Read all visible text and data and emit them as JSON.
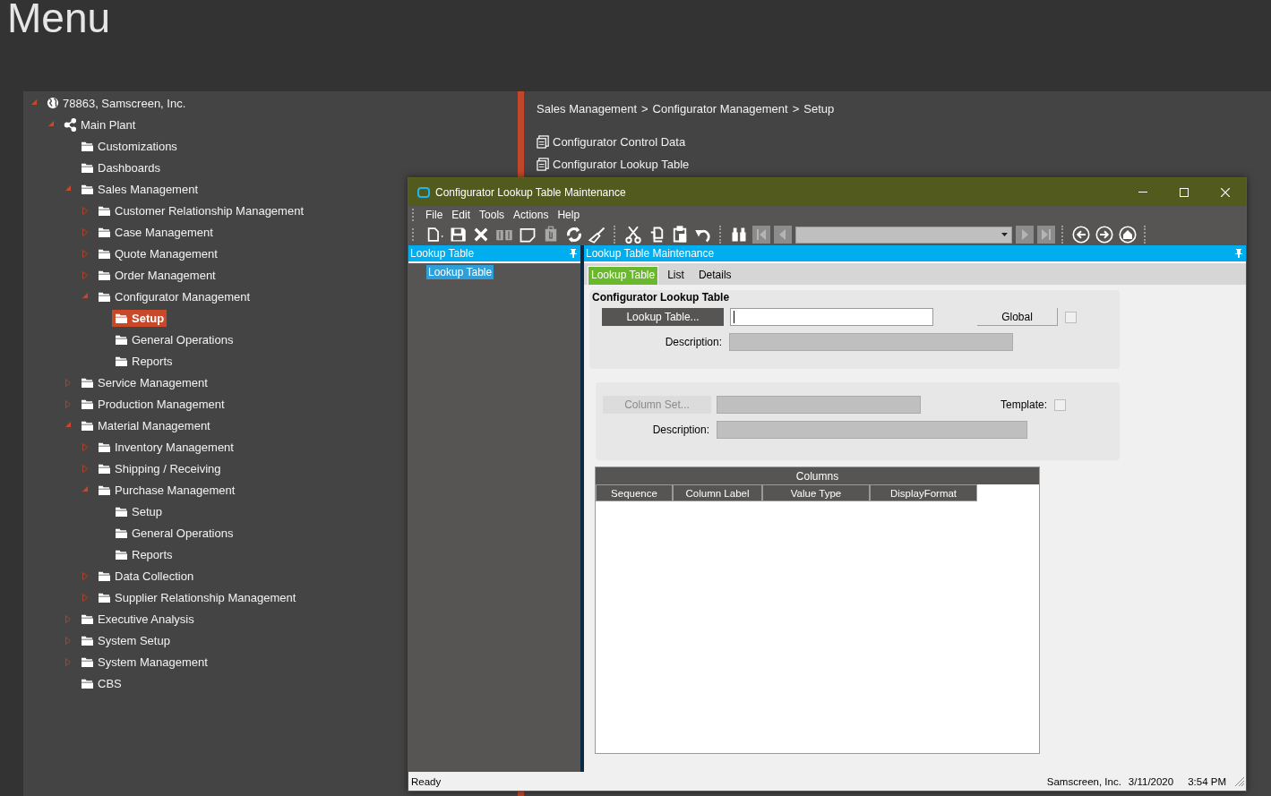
{
  "page_title": "Menu",
  "tree": [
    {
      "label": "78863, Samscreen, Inc.",
      "kind": "globe",
      "expanded": true,
      "selected": false,
      "children": [
        {
          "label": "Main Plant",
          "kind": "share",
          "expanded": true,
          "selected": false,
          "children": [
            {
              "label": "Customizations",
              "kind": "folder",
              "selected": false
            },
            {
              "label": "Dashboards",
              "kind": "folder",
              "selected": false
            },
            {
              "label": "Sales Management",
              "kind": "folder",
              "expanded": true,
              "selected": false,
              "children": [
                {
                  "label": "Customer Relationship Management",
                  "kind": "folder",
                  "expanded": false,
                  "selected": false
                },
                {
                  "label": "Case Management",
                  "kind": "folder",
                  "expanded": false,
                  "selected": false
                },
                {
                  "label": "Quote Management",
                  "kind": "folder",
                  "expanded": false,
                  "selected": false
                },
                {
                  "label": "Order Management",
                  "kind": "folder",
                  "expanded": false,
                  "selected": false
                },
                {
                  "label": "Configurator Management",
                  "kind": "folder",
                  "expanded": true,
                  "selected": false,
                  "children": [
                    {
                      "label": "Setup",
                      "kind": "folder",
                      "selected": true
                    },
                    {
                      "label": "General Operations",
                      "kind": "folder",
                      "selected": false
                    },
                    {
                      "label": "Reports",
                      "kind": "folder",
                      "selected": false
                    }
                  ]
                }
              ]
            },
            {
              "label": "Service Management",
              "kind": "folder",
              "expanded": false,
              "selected": false
            },
            {
              "label": "Production Management",
              "kind": "folder",
              "expanded": false,
              "selected": false
            },
            {
              "label": "Material Management",
              "kind": "folder",
              "expanded": true,
              "selected": false,
              "children": [
                {
                  "label": "Inventory Management",
                  "kind": "folder",
                  "expanded": false,
                  "selected": false
                },
                {
                  "label": "Shipping / Receiving",
                  "kind": "folder",
                  "expanded": false,
                  "selected": false
                },
                {
                  "label": "Purchase Management",
                  "kind": "folder",
                  "expanded": true,
                  "selected": false,
                  "children": [
                    {
                      "label": "Setup",
                      "kind": "folder",
                      "selected": false
                    },
                    {
                      "label": "General Operations",
                      "kind": "folder",
                      "selected": false
                    },
                    {
                      "label": "Reports",
                      "kind": "folder",
                      "selected": false
                    }
                  ]
                },
                {
                  "label": "Data Collection",
                  "kind": "folder",
                  "expanded": false,
                  "selected": false
                },
                {
                  "label": "Supplier Relationship Management",
                  "kind": "folder",
                  "expanded": false,
                  "selected": false
                }
              ]
            },
            {
              "label": "Executive Analysis",
              "kind": "folder",
              "expanded": false,
              "selected": false
            },
            {
              "label": "System Setup",
              "kind": "folder",
              "expanded": false,
              "selected": false
            },
            {
              "label": "System Management",
              "kind": "folder",
              "expanded": false,
              "selected": false
            },
            {
              "label": "CBS",
              "kind": "folder",
              "selected": false
            }
          ]
        }
      ]
    }
  ],
  "breadcrumb": {
    "separator": ">",
    "items": [
      "Sales Management",
      "Configurator Management",
      "Setup"
    ]
  },
  "links": [
    "Configurator Control Data",
    "Configurator Lookup Table"
  ],
  "window": {
    "title": "Configurator Lookup Table Maintenance",
    "menu": [
      "File",
      "Edit",
      "Tools",
      "Actions",
      "Help"
    ],
    "toolbar": [
      {
        "kind": "new",
        "disabled": false
      },
      {
        "kind": "save",
        "disabled": false
      },
      {
        "kind": "delete",
        "disabled": false
      },
      {
        "kind": "book",
        "disabled": true
      },
      {
        "kind": "note",
        "disabled": false
      },
      {
        "kind": "attach",
        "disabled": true
      },
      {
        "kind": "refresh",
        "disabled": false
      },
      {
        "kind": "broom",
        "disabled": false
      },
      {
        "kind": "separator"
      },
      {
        "kind": "cut",
        "disabled": false
      },
      {
        "kind": "copy",
        "disabled": false
      },
      {
        "kind": "paste",
        "disabled": false
      },
      {
        "kind": "undo",
        "disabled": false
      },
      {
        "kind": "separator"
      },
      {
        "kind": "binoculars",
        "disabled": false
      },
      {
        "kind": "first",
        "disabled": true
      },
      {
        "kind": "prev",
        "disabled": true
      },
      {
        "kind": "combo",
        "disabled": true
      },
      {
        "kind": "next",
        "disabled": true
      },
      {
        "kind": "last",
        "disabled": true
      },
      {
        "kind": "separator"
      },
      {
        "kind": "back",
        "disabled": false
      },
      {
        "kind": "forward",
        "disabled": false
      },
      {
        "kind": "home",
        "disabled": false
      },
      {
        "kind": "separator"
      }
    ],
    "left_pane": {
      "header": "Lookup Table",
      "items": [
        {
          "label": "Lookup Table",
          "selected": true
        }
      ]
    },
    "right_pane": {
      "header": "Lookup Table Maintenance",
      "tabs": [
        {
          "label": "Lookup Table",
          "selected": true
        },
        {
          "label": "List",
          "selected": false
        },
        {
          "label": "Details",
          "selected": false
        }
      ],
      "lookup_group": {
        "title": "Configurator Lookup Table",
        "button": {
          "label": "Lookup Table...",
          "disabled": false
        },
        "field": {
          "disabled": false
        },
        "global": {
          "label": "Global",
          "checked": false
        },
        "description": {
          "label": "Description:",
          "disabled": true
        }
      },
      "column_set_group": {
        "button": {
          "label": "Column Set...",
          "disabled": true
        },
        "field": {
          "disabled": true
        },
        "template": {
          "label": "Template:",
          "checked": false
        },
        "description": {
          "label": "Description:",
          "disabled": true
        }
      },
      "grid": {
        "title": "Columns",
        "columns": [
          "Sequence",
          "Column Label",
          "Value Type",
          "DisplayFormat"
        ]
      }
    },
    "status_bar": {
      "text": "Ready",
      "company": "Samscreen, Inc.",
      "date": "3/11/2020",
      "time": "3:54 PM"
    }
  }
}
